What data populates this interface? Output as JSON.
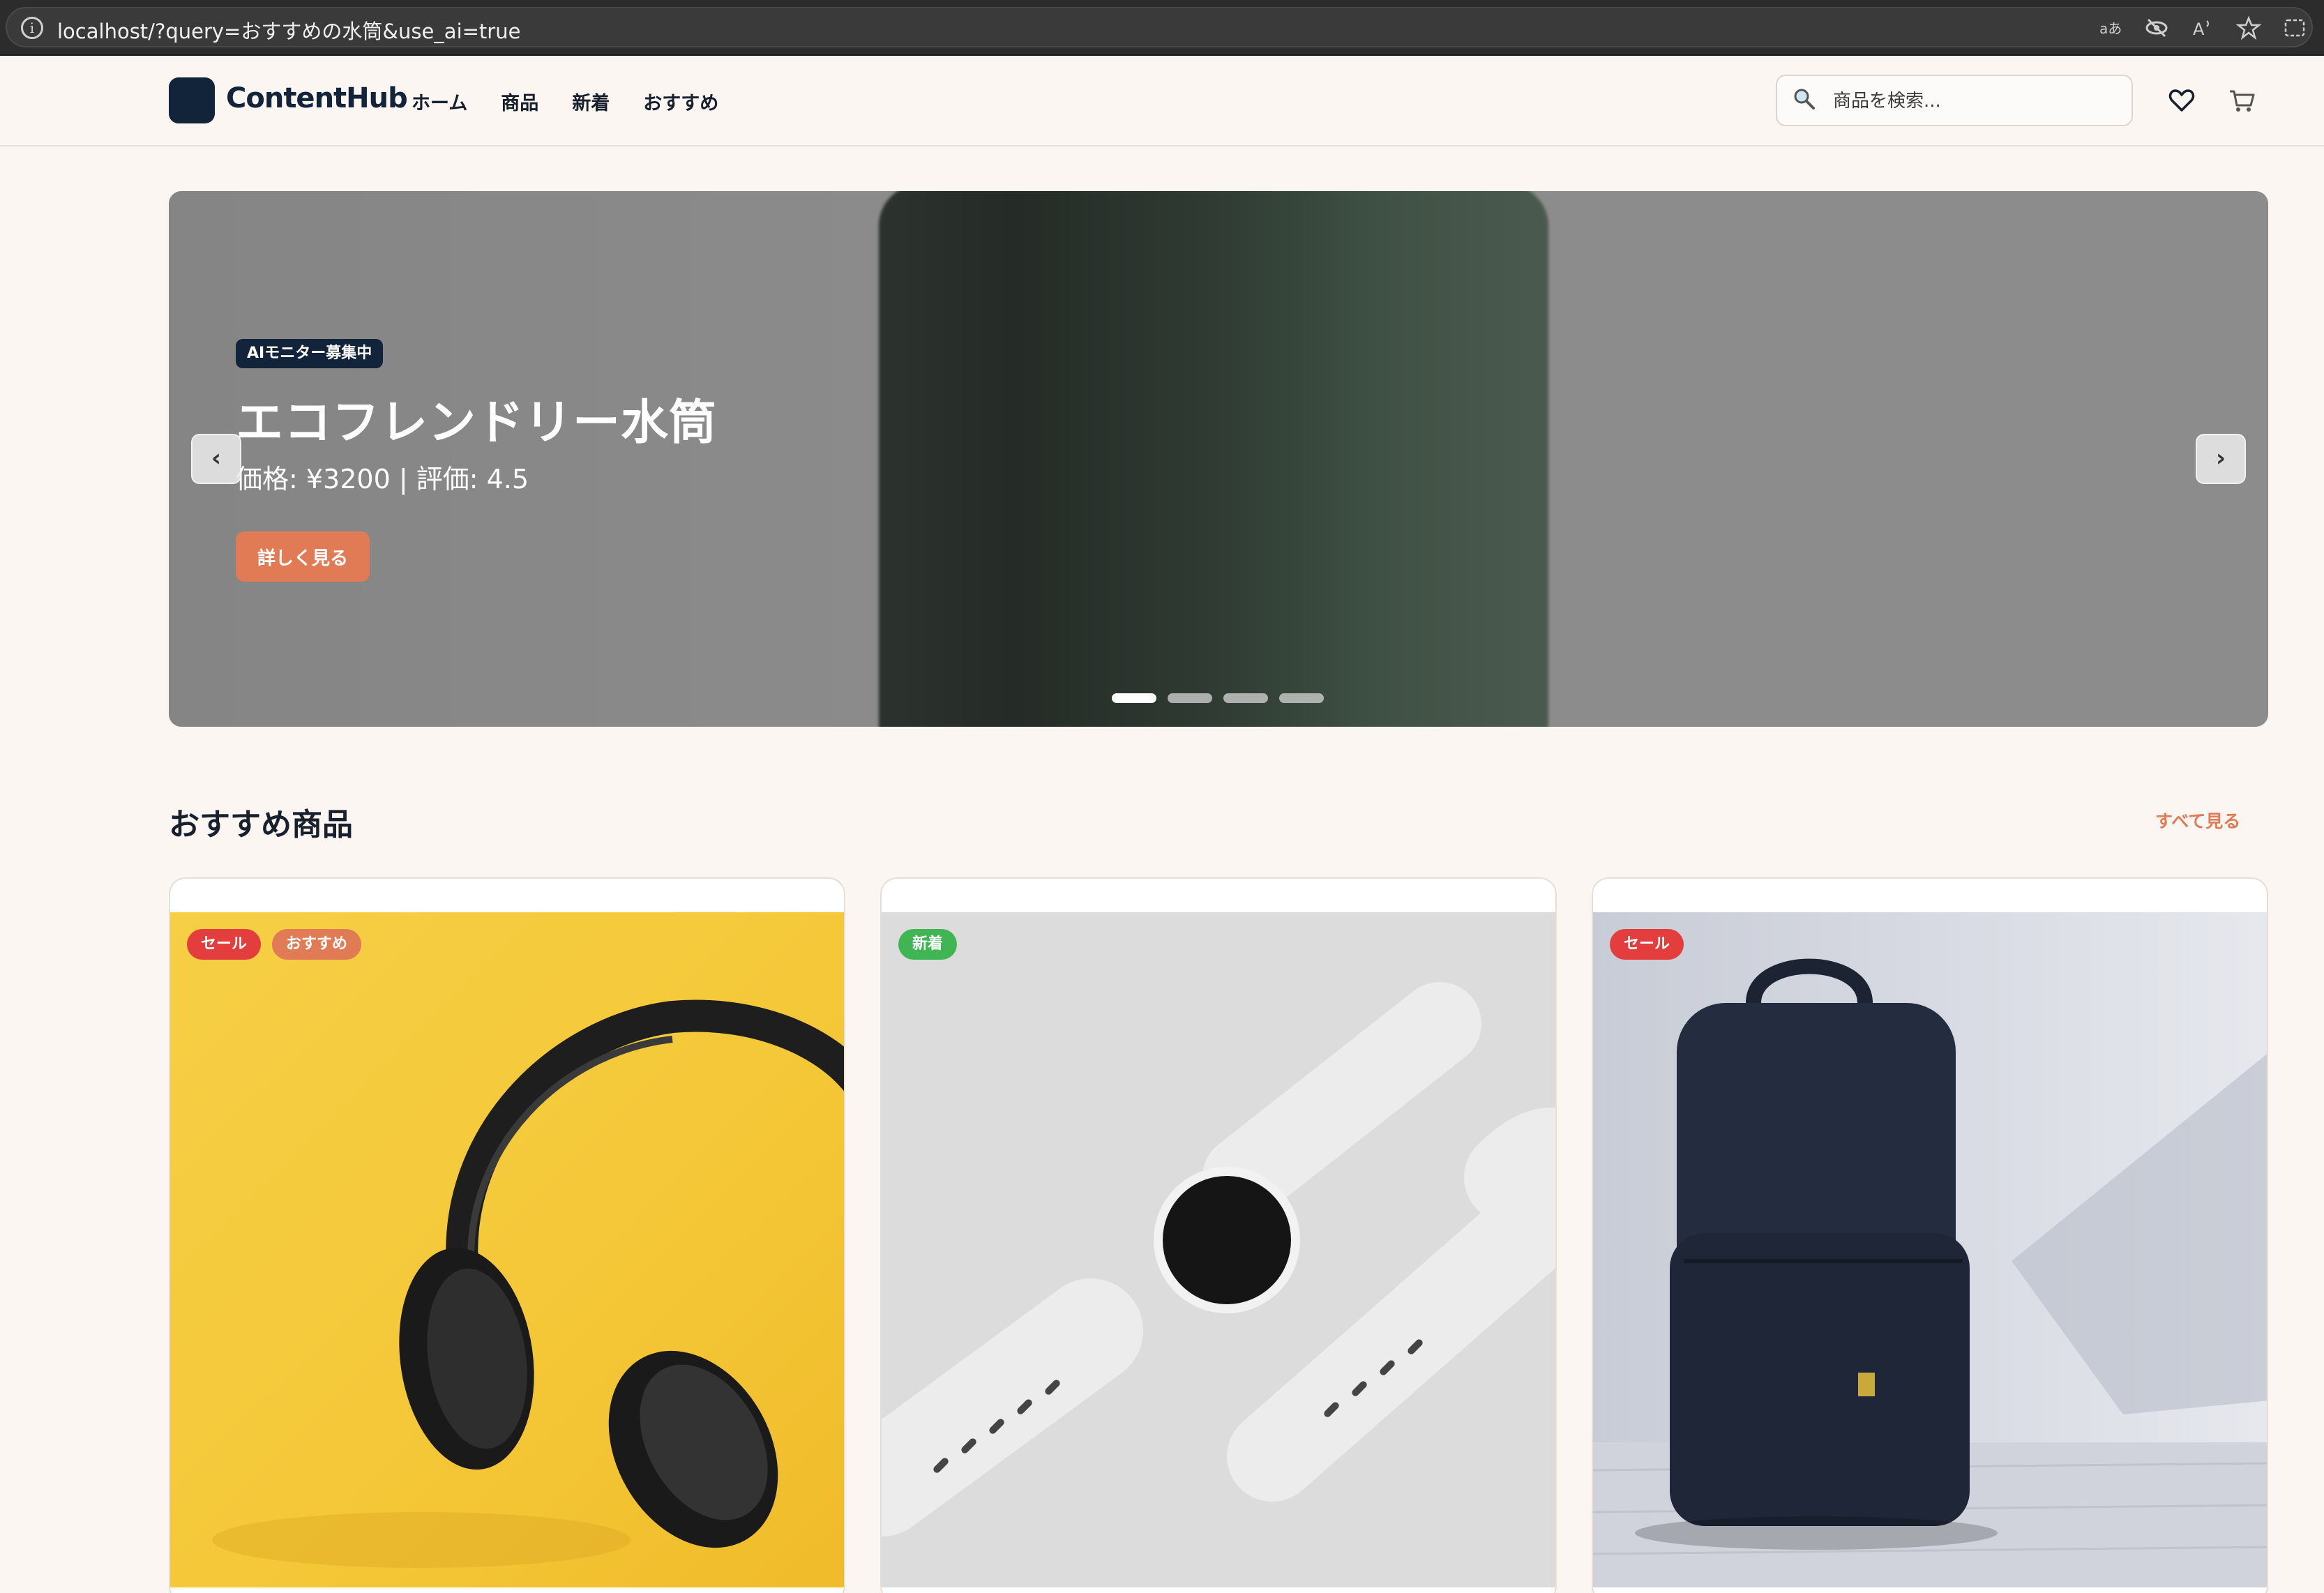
{
  "browser": {
    "url": "localhost/?query=おすすめの水筒&use_ai=true",
    "icons": [
      "translate-icon",
      "tracking-eye-icon",
      "read-aloud-icon",
      "favorite-star-icon",
      "screenshot-icon"
    ]
  },
  "header": {
    "brand": "ContentHub",
    "nav": [
      "ホーム",
      "商品",
      "新着",
      "おすすめ"
    ],
    "search_placeholder": "商品を検索..."
  },
  "hero": {
    "badge": "AIモニター募集中",
    "title": "エコフレンドリー水筒",
    "subtitle": "価格: ¥3200 | 評価: 4.5",
    "cta": "詳しく見る",
    "prev": "‹",
    "next": "›",
    "slide_count": 4,
    "active_slide": 1
  },
  "section": {
    "title": "おすすめ商品",
    "see_all": "すべて見る"
  },
  "products": [
    {
      "badges": [
        "セール",
        "おすすめ"
      ],
      "image": "headphones-on-yellow"
    },
    {
      "badges": [
        "新着"
      ],
      "image": "white-smartwatch"
    },
    {
      "badges": [
        "セール"
      ],
      "image": "navy-backpack"
    }
  ],
  "colors": {
    "accent": "#e07b55",
    "brand_dark": "#12243a",
    "sale": "#e33d3d",
    "new": "#3fb653",
    "page_bg": "#fbf6f2"
  }
}
